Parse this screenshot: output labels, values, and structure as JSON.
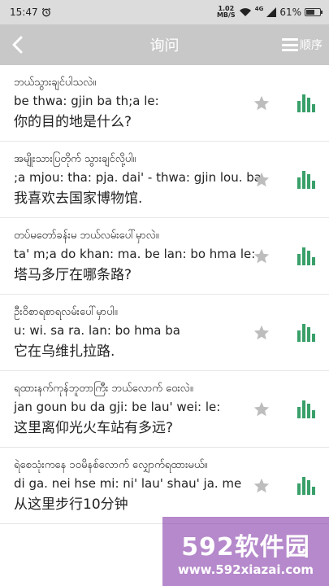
{
  "status_bar": {
    "time": "15:47",
    "net_speed_value": "1.02",
    "net_speed_unit": "MB/S",
    "signal_label": "4G",
    "battery_percent": "61%",
    "battery_level": 0.61
  },
  "app_bar": {
    "title": "询问",
    "order_label": "顺序"
  },
  "phrases": [
    {
      "burmese": "ဘယ်သွားချင်ပါသလဲ။",
      "roman": "be thwa: gjin ba th;a le:",
      "chinese": "你的目的地是什么?"
    },
    {
      "burmese": "အမျိုးသားပြတိုက် သွားချင်လို့ပါ။",
      "roman": ";a mjou: tha: pja. dai' - thwa: gjin lou. ba",
      "chinese": "我喜欢去国家博物馆."
    },
    {
      "burmese": "တပ်မတော်ခန်းမ ဘယ်လမ်းပေါ်မှာလဲ။",
      "roman": "ta' m;a do khan: ma. be lan: bo hma le:",
      "chinese": "塔马多厅在哪条路?"
    },
    {
      "burmese": "ဦးဝိစာရစာရလမ်းပေါ်မှာပါ။",
      "roman": "u: wi. sa ra. lan: bo hma ba",
      "chinese": "它在乌维扎拉路."
    },
    {
      "burmese": "ရထားနက်ကုန်ဘူတာကြီး ဘယ်လောက် ဝေးလဲ။",
      "roman": "jan goun bu da gji: be lau' wei: le:",
      "chinese": "这里离仰光火车站有多远?"
    },
    {
      "burmese": "ရဲစေသုံးကနေ ၁၀မိနစ်လောက် လျှောက်ရထားမယ်။",
      "roman": "di ga. nei hse mi: ni' lau' shau' ja. me",
      "chinese": "从这里步行10分钟"
    }
  ],
  "watermark": {
    "title": "592软件园",
    "url": "www.592xiazai.com"
  },
  "colors": {
    "app_bar_bg": "#c8c8c8",
    "accent_green": "#3aa06a",
    "star_gray": "#bdbdbd"
  }
}
